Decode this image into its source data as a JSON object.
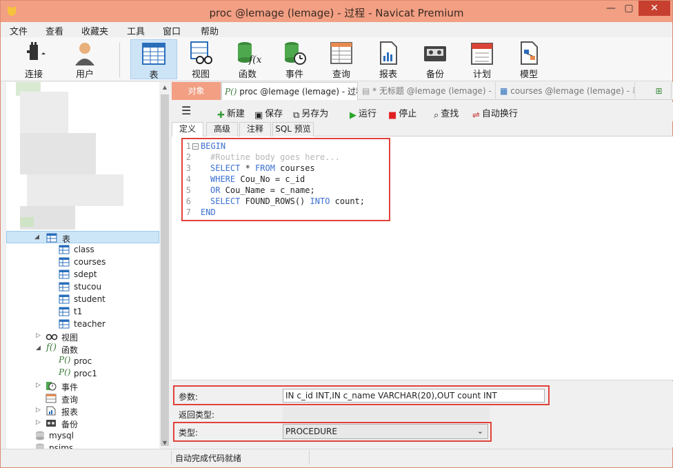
{
  "window": {
    "title": "proc @lemage (lemage) - 过程 - Navicat Premium",
    "minimize": "—",
    "maximize": "▢",
    "close": "✕"
  },
  "menu": [
    "文件",
    "查看",
    "收藏夹",
    "工具",
    "窗口",
    "帮助"
  ],
  "toolbar": {
    "connect": "连接",
    "user": "用户",
    "table": "表",
    "view": "视图",
    "function": "函数",
    "event": "事件",
    "query": "查询",
    "report": "报表",
    "backup": "备份",
    "schedule": "计划",
    "model": "模型"
  },
  "sidebar": {
    "tables_label": "表",
    "tables": [
      "class",
      "courses",
      "sdept",
      "stucou",
      "student",
      "t1",
      "teacher"
    ],
    "views_label": "视图",
    "functions_label": "函数",
    "functions": [
      "proc",
      "proc1"
    ],
    "events_label": "事件",
    "queries_label": "查询",
    "reports_label": "报表",
    "backups_label": "备份",
    "databases": [
      "mysql",
      "psims"
    ]
  },
  "tabs": {
    "objects": "对象",
    "current": "proc @lemage (lemage) - 过程",
    "untitled": "* 无标题 @lemage (lemage) - ...",
    "courses": "courses @lemage (lemage) - 表"
  },
  "editor_toolbar": {
    "new": "新建",
    "save": "保存",
    "save_as": "另存为",
    "run": "运行",
    "stop": "停止",
    "find": "查找",
    "word_wrap": "自动换行"
  },
  "subtabs": {
    "definition": "定义",
    "advanced": "高级",
    "comment": "注释",
    "sql_preview": "SQL 预览"
  },
  "code": {
    "lines": [
      {
        "n": "1",
        "kw": "BEGIN",
        "rest": ""
      },
      {
        "n": "2",
        "cm": "#Routine body goes here..."
      },
      {
        "n": "3",
        "parts": [
          [
            "kw",
            "SELECT"
          ],
          [
            "t",
            " * "
          ],
          [
            "kw",
            "FROM"
          ],
          [
            "t",
            " courses"
          ]
        ]
      },
      {
        "n": "4",
        "parts": [
          [
            "kw",
            "WHERE"
          ],
          [
            "t",
            " Cou_No = c_id"
          ]
        ]
      },
      {
        "n": "5",
        "parts": [
          [
            "kw",
            "OR"
          ],
          [
            "t",
            " Cou_Name = c_name;"
          ]
        ]
      },
      {
        "n": "6",
        "parts": [
          [
            "kw",
            "SELECT"
          ],
          [
            "t",
            " FOUND_ROWS() "
          ],
          [
            "kw",
            "INTO"
          ],
          [
            "t",
            " count;"
          ]
        ]
      },
      {
        "n": "7",
        "kw": "END",
        "rest": ""
      }
    ]
  },
  "properties": {
    "params_label": "参数:",
    "params_value": "IN c_id INT,IN c_name VARCHAR(20),OUT count INT",
    "return_label": "返回类型:",
    "return_value": "",
    "type_label": "类型:",
    "type_value": "PROCEDURE"
  },
  "status": {
    "text": "自动完成代码就绪"
  },
  "colors": {
    "accent": "#f29f83",
    "highlight": "#e0413a",
    "keyword": "#3b6fd1"
  }
}
